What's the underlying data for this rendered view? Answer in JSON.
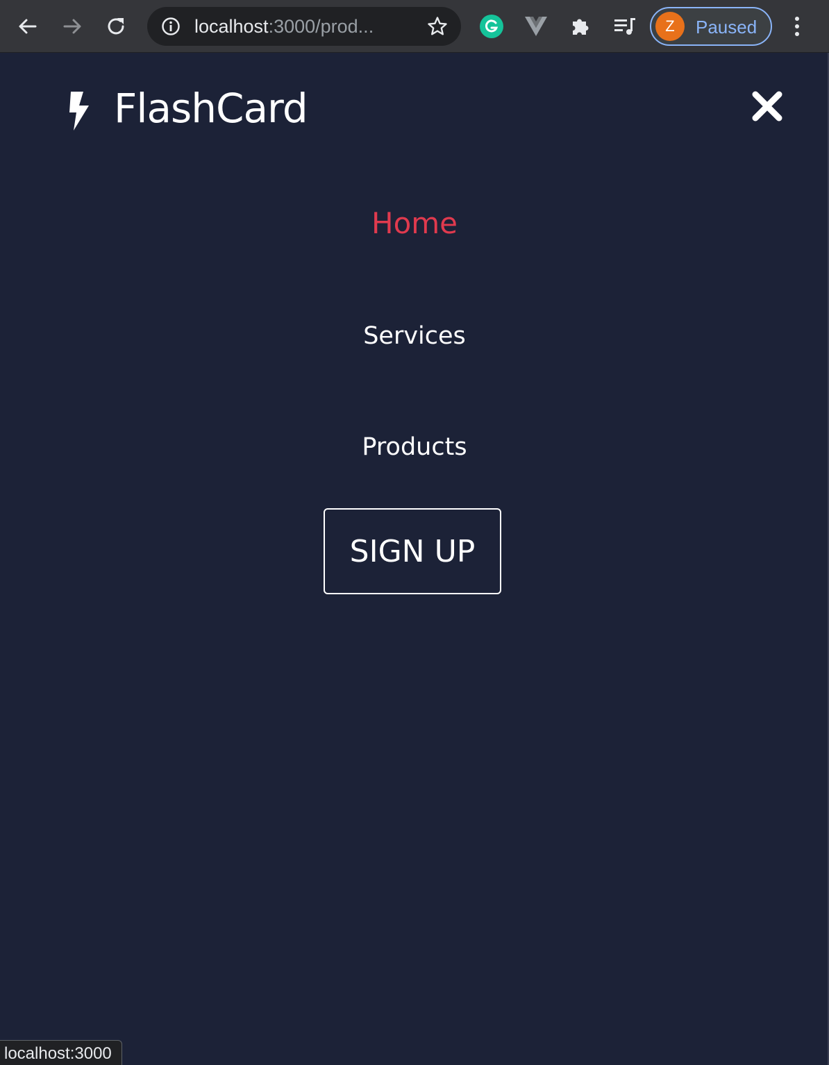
{
  "browser": {
    "url_host": "localhost",
    "url_path": ":3000/prod...",
    "profile_initial": "Z",
    "profile_status": "Paused",
    "extensions": [
      "grammarly-icon",
      "vue-devtools-icon",
      "extensions-puzzle-icon",
      "media-queue-icon"
    ],
    "accent_color": "#8ab4f8"
  },
  "page": {
    "brand": "FlashCard",
    "nav": {
      "home": "Home",
      "services": "Services",
      "products": "Products",
      "signup": "SIGN UP"
    },
    "active_color": "#e03a4e",
    "background_color": "#1c2237"
  },
  "status_bar": {
    "text": "localhost:3000"
  }
}
